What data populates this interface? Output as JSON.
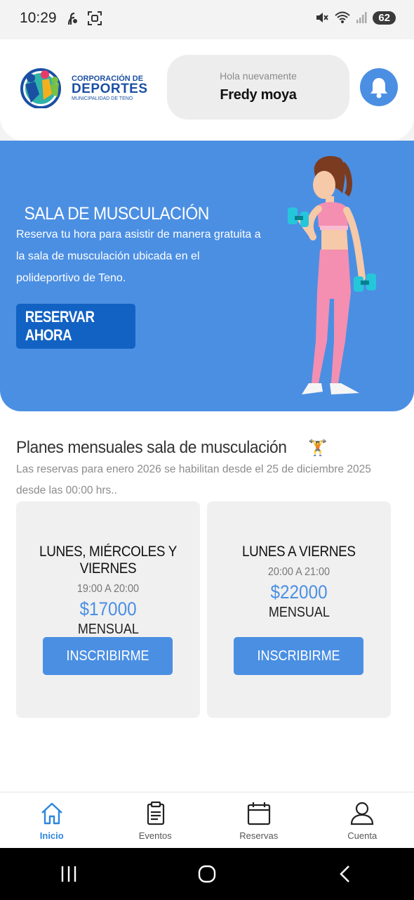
{
  "status_bar": {
    "time": "10:29",
    "battery": "62"
  },
  "header": {
    "logo": {
      "line1": "CORPORACIÓN DE",
      "line2": "DEPORTES",
      "line3": "MUNICIPALIDAD DE TENO"
    },
    "greeting_small": "Hola nuevamente",
    "user_name": "Fredy moya"
  },
  "hero": {
    "title": "SALA DE MUSCULACIÓN",
    "description": "Reserva tu hora para asistir de manera gratuita a la sala de musculación ubicada en el polideportivo de Teno.",
    "button_label": "RESERVAR AHORA"
  },
  "plans": {
    "title": "Planes mensuales sala de musculación",
    "title_emoji": "🏋️",
    "note": "Las reservas para enero 2026 se habilitan desde el 25 de diciembre 2025 desde las 00:00 hrs..",
    "items": [
      {
        "days": "LUNES, MIÉRCOLES Y VIERNES",
        "hours": "19:00 A 20:00",
        "price": "$17000",
        "period": "MENSUAL",
        "button_label": "INSCRIBIRME"
      },
      {
        "days": "LUNES A VIERNES",
        "hours": "20:00 A 21:00",
        "price": "$22000",
        "period": "MENSUAL",
        "button_label": "INSCRIBIRME"
      }
    ]
  },
  "bottom_nav": {
    "items": [
      {
        "label": "Inicio",
        "icon": "home-icon",
        "active": true
      },
      {
        "label": "Eventos",
        "icon": "clipboard-icon",
        "active": false
      },
      {
        "label": "Reservas",
        "icon": "calendar-icon",
        "active": false
      },
      {
        "label": "Cuenta",
        "icon": "user-icon",
        "active": false
      }
    ]
  },
  "colors": {
    "accent": "#4b8fe3",
    "hero_button": "#1262c4",
    "active_nav": "#2e86de",
    "card_bg": "#f0f0f0"
  }
}
